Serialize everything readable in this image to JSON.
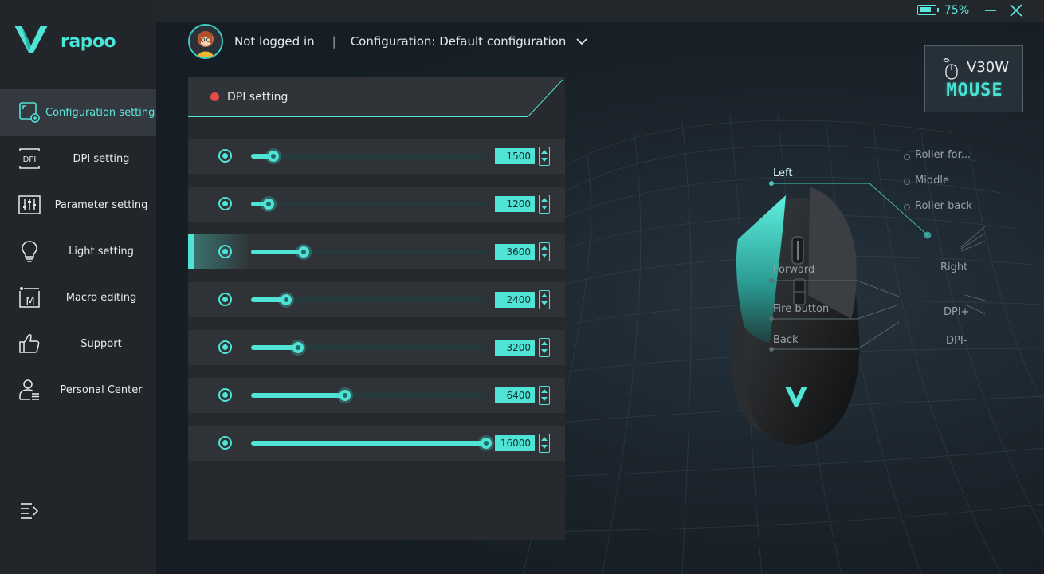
{
  "app": {
    "logo_text": "rapoo",
    "battery_percent": 75,
    "battery_label": "75%"
  },
  "sidebar": {
    "items": [
      {
        "label": "Configuration setting",
        "icon": "config-icon",
        "active": true
      },
      {
        "label": "DPI setting",
        "icon": "dpi-icon",
        "active": false
      },
      {
        "label": "Parameter setting",
        "icon": "sliders-icon",
        "active": false
      },
      {
        "label": "Light setting",
        "icon": "bulb-icon",
        "active": false
      },
      {
        "label": "Macro editing",
        "icon": "macro-icon",
        "active": false
      },
      {
        "label": "Support",
        "icon": "thumbs-up-icon",
        "active": false
      },
      {
        "label": "Personal Center",
        "icon": "user-icon",
        "active": false
      }
    ]
  },
  "header": {
    "user_status": "Not logged in",
    "separator": "|",
    "configuration": "Configuration: Default configuration"
  },
  "panel": {
    "title": "DPI setting",
    "max_dpi": 16000,
    "levels": [
      {
        "value": "1500",
        "dpi": 1500,
        "active": false
      },
      {
        "value": "1200",
        "dpi": 1200,
        "active": false
      },
      {
        "value": "3600",
        "dpi": 3600,
        "active": true
      },
      {
        "value": "2400",
        "dpi": 2400,
        "active": false
      },
      {
        "value": "3200",
        "dpi": 3200,
        "active": false
      },
      {
        "value": "6400",
        "dpi": 6400,
        "active": false
      },
      {
        "value": "16000",
        "dpi": 16000,
        "active": false
      }
    ]
  },
  "device": {
    "model": "V30W",
    "type": "MOUSE"
  },
  "mouse_buttons": {
    "left": "Left",
    "forward": "Forward",
    "fire": "Fire button",
    "back": "Back",
    "roller_forward": "Roller for...",
    "middle": "Middle",
    "roller_back": "Roller back",
    "right": "Right",
    "dpi_plus": "DPI+",
    "dpi_minus": "DPI-"
  },
  "colors": {
    "accent": "#4fe3d6",
    "sidebar_bg": "#22262a",
    "panel_bg": "#26292d",
    "status_dot": "#e84a4a"
  }
}
